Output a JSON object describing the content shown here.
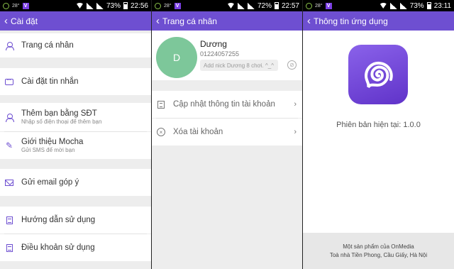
{
  "status": [
    {
      "temp": "28°",
      "battery": "73%",
      "time": "22:56"
    },
    {
      "temp": "28°",
      "battery": "72%",
      "time": "22:57"
    },
    {
      "temp": "28°",
      "battery": "73%",
      "time": "23:11"
    }
  ],
  "settings": {
    "title": "Cài đặt",
    "items": [
      {
        "label": "Trang cá nhân",
        "icon": "person-icon"
      },
      {
        "label": "Cài đặt tin nhắn",
        "icon": "chat-icon"
      },
      {
        "label": "Thêm bạn bằng SĐT",
        "sub": "Nhập số điện thoại để thêm bạn",
        "icon": "add-person-icon"
      },
      {
        "label": "Giới thiệu Mocha",
        "sub": "Gửi SMS để mời bạn",
        "icon": "pencil-icon"
      },
      {
        "label": "Gửi email góp ý",
        "icon": "mail-icon"
      },
      {
        "label": "Hướng dẫn sử dụng",
        "icon": "guide-icon"
      },
      {
        "label": "Điều khoản sử dụng",
        "icon": "doc-icon"
      }
    ]
  },
  "profile": {
    "title": "Trang cá nhân",
    "avatar_letter": "D",
    "name": "Dương",
    "phone": "01224057255",
    "nick_placeholder": "Add nick Dương 8 chơi. ^_^",
    "actions": [
      {
        "label": "Cập nhật thông tin tài khoản",
        "icon": "edit-doc-icon"
      },
      {
        "label": "Xóa tài khoản",
        "icon": "x-circle-icon"
      }
    ]
  },
  "about": {
    "title": "Thông tin ứng dụng",
    "version": "Phiên bản hiện tại: 1.0.0",
    "footer_line1": "Một sản phẩm của OnMedia",
    "footer_line2": "Toà nhà Tiền Phong, Cầu Giấy, Hà Nội"
  },
  "colors": {
    "accent": "#6e4fd1",
    "avatar": "#7dc79a"
  }
}
